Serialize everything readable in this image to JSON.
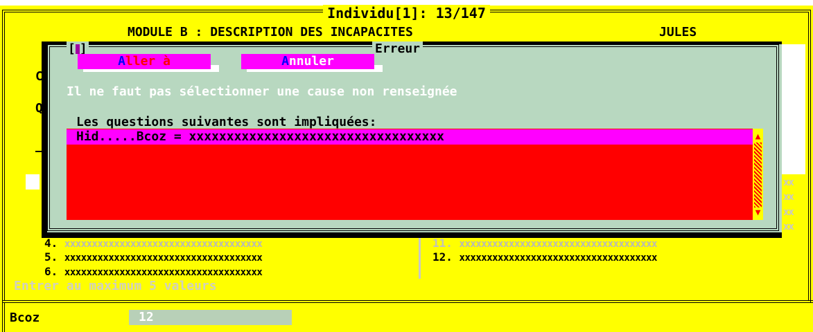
{
  "window": {
    "title": "Individu[1]: 13/147",
    "module_title": "MODULE B : DESCRIPTION DES INCAPACITES",
    "person_name": "JULES"
  },
  "background_letters": [
    "C",
    "Q"
  ],
  "side_values": [
    "xx",
    "xx",
    "xx",
    "xx"
  ],
  "answers": {
    "left": [
      {
        "num": "4.",
        "value": "xxxxxxxxxxxxxxxxxxxxxxxxxxxxxxxxxxxx",
        "dimmed": true
      },
      {
        "num": "5.",
        "value": "xxxxxxxxxxxxxxxxxxxxxxxxxxxxxxxxxxxx",
        "dimmed": false
      },
      {
        "num": "6.",
        "value": "xxxxxxxxxxxxxxxxxxxxxxxxxxxxxxxxxxxx",
        "dimmed": false
      }
    ],
    "right": [
      {
        "num": "11.",
        "value": "xxxxxxxxxxxxxxxxxxxxxxxxxxxxxxxxxxxx",
        "dimmed": true
      },
      {
        "num": "12.",
        "value": "xxxxxxxxxxxxxxxxxxxxxxxxxxxxxxxxxxxx",
        "dimmed": false
      }
    ]
  },
  "hint": "Entrer au maximum 5 valeurs",
  "field": {
    "label": "Bcoz",
    "value": "12"
  },
  "dialog": {
    "close_symbol": "[",
    "close_symbol_end": "]",
    "title": "Erreur",
    "buttons": {
      "goto": {
        "hotkey": "A",
        "rest": "ller à"
      },
      "cancel": {
        "hotkey": "A",
        "rest": "nnuler"
      }
    },
    "message": "Il ne faut pas sélectionner une cause non renseignée",
    "list_label": "Les questions suivantes sont impliquées:",
    "items": [
      "Hid.....Bcoz = xxxxxxxxxxxxxxxxxxxxxxxxxxxxxxxxxx"
    ],
    "scroll_up": "▲",
    "scroll_down": "▼"
  },
  "colors": {
    "background": "#ffff00",
    "dialog": "#b8d8c0",
    "list": "#ff0000",
    "selection": "#ff00ff",
    "hotkey": "#0000ff"
  }
}
